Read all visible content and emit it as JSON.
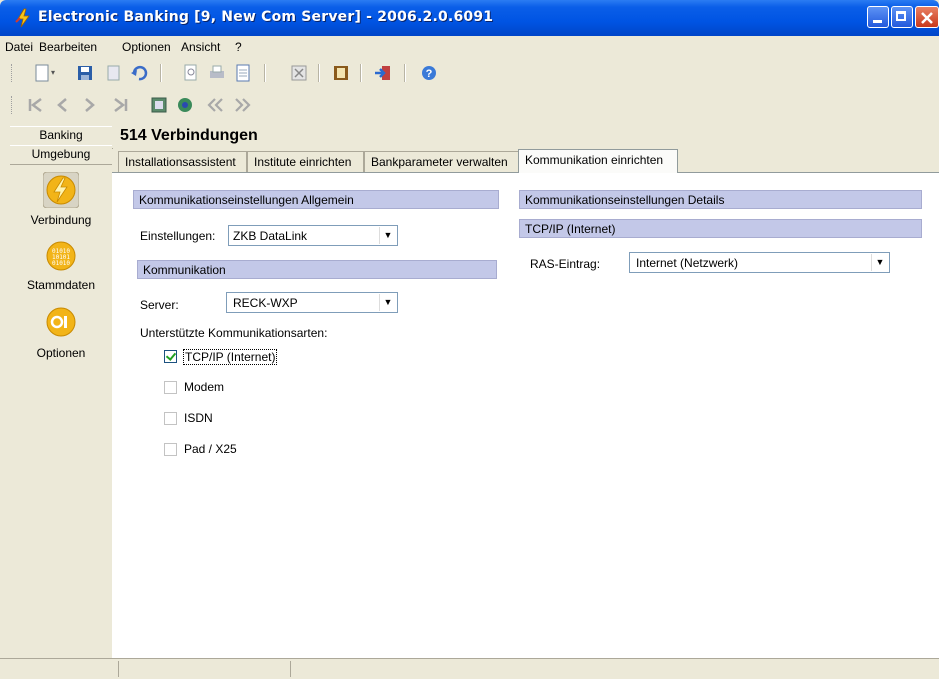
{
  "window": {
    "title": "Electronic Banking [9, New Com Server] - 2006.2.0.6091",
    "colors": {
      "titlebar": "#0054e3",
      "section_header": "#c3c8e8",
      "active_tab": "#fbfbf9"
    }
  },
  "menu": {
    "items": [
      "Datei",
      "Bearbeiten",
      "Optionen",
      "Ansicht",
      "?"
    ]
  },
  "toolbar1": {
    "icons": [
      "new-document-icon",
      "save-icon",
      "save-copy-icon",
      "undo-icon",
      "print-preview-icon",
      "print-icon",
      "document-icon",
      "delete-icon",
      "book-icon",
      "exit-icon",
      "help-icon"
    ]
  },
  "toolbar2": {
    "icons": [
      "first-record-icon",
      "previous-record-icon",
      "next-record-icon",
      "last-record-icon",
      "details-icon",
      "refresh-icon",
      "scroll-back-icon",
      "scroll-forward-icon"
    ]
  },
  "leftnav": {
    "headers": [
      "Banking",
      "Umgebung"
    ],
    "items": [
      {
        "label": "Verbindung",
        "icon": "lightning-icon"
      },
      {
        "label": "Stammdaten",
        "icon": "binary-data-icon"
      },
      {
        "label": "Optionen",
        "icon": "options-toggle-icon"
      }
    ]
  },
  "main": {
    "title": "514 Verbindungen",
    "tabs": [
      "Installationsassistent",
      "Institute einrichten",
      "Bankparameter verwalten",
      "Kommunikation einrichten"
    ],
    "active_tab": "Kommunikation einrichten"
  },
  "left_section": {
    "header": "Kommunikationseinstellungen Allgemein",
    "einstellungen_label": "Einstellungen:",
    "einstellungen_value": "ZKB DataLink",
    "komm_header": "Kommunikation",
    "server_label": "Server:",
    "server_value": "RECK-WXP",
    "supported_label": "Unterstützte Kommunikationsarten:",
    "options": [
      {
        "label": "TCP/IP (Internet)",
        "checked": true
      },
      {
        "label": "Modem",
        "checked": false
      },
      {
        "label": "ISDN",
        "checked": false
      },
      {
        "label": "Pad / X25",
        "checked": false
      }
    ]
  },
  "right_section": {
    "header": "Kommunikationseinstellungen Details",
    "sub_header": "TCP/IP (Internet)",
    "ras_label": "RAS-Eintrag:",
    "ras_value": "Internet (Netzwerk)"
  }
}
